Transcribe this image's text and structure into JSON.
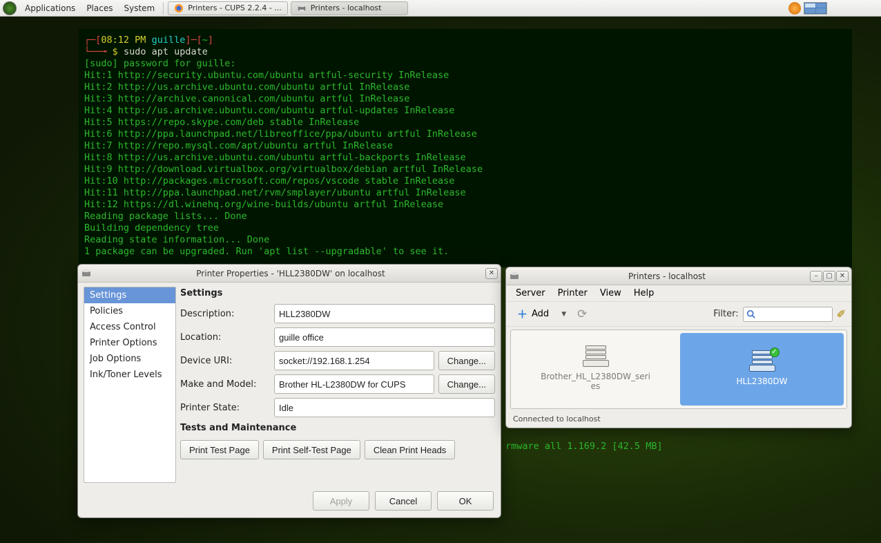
{
  "panel": {
    "menus": [
      "Applications",
      "Places",
      "System"
    ],
    "task1": "Printers - CUPS 2.2.4 - ...",
    "task2": "Printers - localhost"
  },
  "terminal": {
    "time": "08:12 PM",
    "user": "guille",
    "cwd": "~",
    "prompt": "$",
    "cmd": "sudo apt update",
    "sudo_line": "[sudo] password for guille:",
    "hits": [
      "Hit:1 http://security.ubuntu.com/ubuntu artful-security InRelease",
      "Hit:2 http://us.archive.ubuntu.com/ubuntu artful InRelease",
      "Hit:3 http://archive.canonical.com/ubuntu artful InRelease",
      "Hit:4 http://us.archive.ubuntu.com/ubuntu artful-updates InRelease",
      "Hit:5 https://repo.skype.com/deb stable InRelease",
      "Hit:6 http://ppa.launchpad.net/libreoffice/ppa/ubuntu artful InRelease",
      "Hit:7 http://repo.mysql.com/apt/ubuntu artful InRelease",
      "Hit:8 http://us.archive.ubuntu.com/ubuntu artful-backports InRelease",
      "Hit:9 http://download.virtualbox.org/virtualbox/debian artful InRelease",
      "Hit:10 http://packages.microsoft.com/repos/vscode stable InRelease",
      "Hit:11 http://ppa.launchpad.net/rvm/smplayer/ubuntu artful InRelease",
      "Hit:12 https://dl.winehq.org/wine-builds/ubuntu artful InRelease"
    ],
    "tail": [
      "Reading package lists... Done",
      "Building dependency tree",
      "Reading state information... Done",
      "1 package can be upgraded. Run 'apt list --upgradable' to see it."
    ],
    "extra": "rmware all 1.169.2 [42.5 MB]"
  },
  "props": {
    "title": "Printer Properties - 'HLL2380DW' on localhost",
    "sidebar": [
      "Settings",
      "Policies",
      "Access Control",
      "Printer Options",
      "Job Options",
      "Ink/Toner Levels"
    ],
    "heading": "Settings",
    "labels": {
      "description": "Description:",
      "location": "Location:",
      "device_uri": "Device URI:",
      "make_model": "Make and Model:",
      "printer_state": "Printer State:"
    },
    "values": {
      "description": "HLL2380DW",
      "location": "guille office",
      "device_uri": "socket://192.168.1.254",
      "make_model": "Brother HL-L2380DW for CUPS",
      "printer_state": "Idle"
    },
    "change": "Change...",
    "tests_heading": "Tests and Maintenance",
    "tests": {
      "print_test": "Print Test Page",
      "self_test": "Print Self-Test Page",
      "clean": "Clean Print Heads"
    },
    "footer": {
      "apply": "Apply",
      "cancel": "Cancel",
      "ok": "OK"
    }
  },
  "printers": {
    "title": "Printers - localhost",
    "menus": [
      "Server",
      "Printer",
      "View",
      "Help"
    ],
    "add": "Add",
    "filter_label": "Filter:",
    "items": [
      {
        "name": "Brother_HL_L2380DW_series",
        "selected": false,
        "default": false
      },
      {
        "name": "HLL2380DW",
        "selected": true,
        "default": true
      }
    ],
    "status": "Connected to localhost"
  }
}
